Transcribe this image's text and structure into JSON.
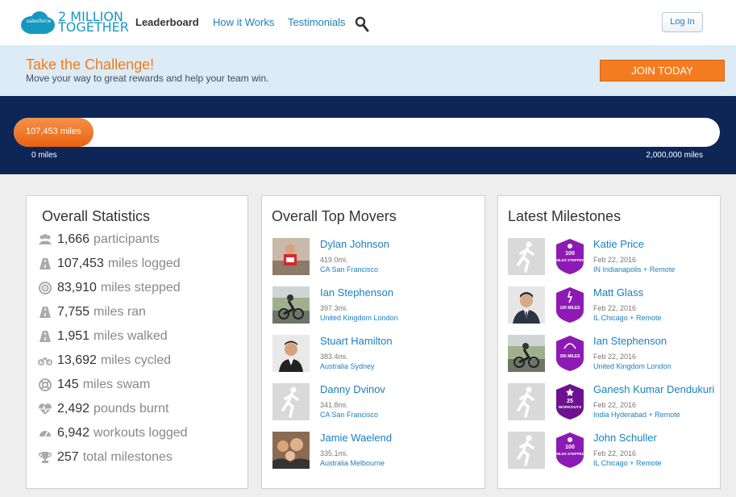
{
  "header": {
    "logo_mark": "salesforce",
    "logo_line1": "2 MILLION",
    "logo_line2": "TOGETHER",
    "nav": {
      "leaderboard": "Leaderboard",
      "how": "How it Works",
      "testimonials": "Testimonials"
    },
    "login_label": "Log In"
  },
  "challenge": {
    "title": "Take the Challenge!",
    "subtitle": "Move your way to great rewards and help your team win.",
    "join_label": "JOIN TODAY"
  },
  "progress": {
    "value_label": "107,453 miles",
    "min_label": "0 miles",
    "max_label": "2,000,000 miles",
    "fill_fraction": 0.113
  },
  "stats": {
    "title": "Overall Statistics",
    "items": [
      {
        "icon": "participants-icon",
        "num": "1,666",
        "label": "participants"
      },
      {
        "icon": "road-icon",
        "num": "107,453",
        "label": "miles logged"
      },
      {
        "icon": "target-icon",
        "num": "83,910",
        "label": "miles stepped"
      },
      {
        "icon": "road-icon",
        "num": "7,755",
        "label": "miles ran"
      },
      {
        "icon": "road-icon",
        "num": "1,951",
        "label": "miles walked"
      },
      {
        "icon": "bicycle-icon",
        "num": "13,692",
        "label": "miles cycled"
      },
      {
        "icon": "lifebuoy-icon",
        "num": "145",
        "label": "miles swam"
      },
      {
        "icon": "heartbeat-icon",
        "num": "2,492",
        "label": "pounds burnt"
      },
      {
        "icon": "gauge-icon",
        "num": "6,942",
        "label": "workouts logged"
      },
      {
        "icon": "trophy-icon",
        "num": "257",
        "label": "total milestones"
      }
    ]
  },
  "movers": {
    "title": "Overall Top Movers",
    "items": [
      {
        "name": "Dylan Johnson",
        "miles": "419.0mi.",
        "location": "CA San Francisco",
        "photo": "runner-photo"
      },
      {
        "name": "Ian Stephenson",
        "miles": "397.3mi.",
        "location": "United Kingdom London",
        "photo": "cyclist-photo"
      },
      {
        "name": "Stuart Hamilton",
        "miles": "383.4mi.",
        "location": "Australia Sydney",
        "photo": "portrait-photo"
      },
      {
        "name": "Danny Dvinov",
        "miles": "341.8mi.",
        "location": "CA San Francisco",
        "photo": "placeholder"
      },
      {
        "name": "Jamie Waelend",
        "miles": "335.1mi.",
        "location": "Australia Melbourne",
        "photo": "group-photo"
      }
    ]
  },
  "milestones": {
    "title": "Latest Milestones",
    "items": [
      {
        "name": "Katie Price",
        "date": "Feb 22, 2016",
        "location": "IN Indianapolis + Remote",
        "photo": "placeholder",
        "badge_top": "100",
        "badge_bottom": "MILES STEPPED"
      },
      {
        "name": "Matt Glass",
        "date": "Feb 22, 2016",
        "location": "IL Chicago + Remote",
        "photo": "portrait-photo",
        "badge_top": "",
        "badge_bottom": "100 MILES"
      },
      {
        "name": "Ian Stephenson",
        "date": "Feb 22, 2016",
        "location": "United Kingdom London",
        "photo": "cyclist-photo",
        "badge_top": "",
        "badge_bottom": "360 MILES"
      },
      {
        "name": "Ganesh Kumar Dendukuri",
        "date": "Feb 22, 2016",
        "location": "India Hyderabad + Remote",
        "photo": "placeholder",
        "badge_top": "25",
        "badge_bottom": "WORKOUTS"
      },
      {
        "name": "John Schuller",
        "date": "Feb 22, 2016",
        "location": "IL Chicago + Remote",
        "photo": "placeholder",
        "badge_top": "100",
        "badge_bottom": "MILES STEPPED"
      }
    ]
  },
  "colors": {
    "brand_blue": "#1798c1",
    "link_blue": "#1a7fc1",
    "accent_orange": "#f47c20",
    "navy": "#0e2656",
    "badge_purple": "#8d1ab5"
  }
}
